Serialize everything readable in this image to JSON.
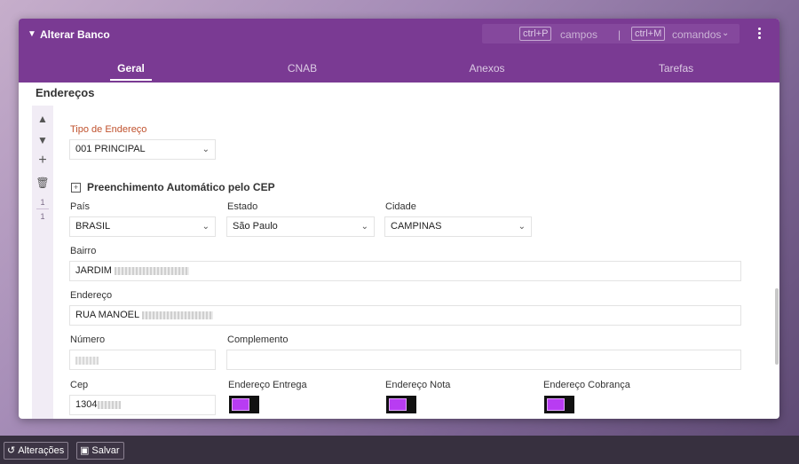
{
  "dialog": {
    "title": "Alterar Banco",
    "shortcuts": {
      "fields_key": "ctrl+P",
      "fields_label": "campos",
      "separator": "|",
      "commands_key": "ctrl+M",
      "commands_label": "comandos"
    },
    "tabs": [
      "Geral",
      "CNAB",
      "Anexos",
      "Tarefas"
    ],
    "active_tab": "Geral"
  },
  "section": {
    "title": "Endereços",
    "rail": {
      "counter_current": "1",
      "counter_total": "1"
    }
  },
  "form": {
    "address_type": {
      "label": "Tipo de Endereço",
      "value": "001 PRINCIPAL"
    },
    "auto_fill_title": "Preenchimento Automático pelo CEP",
    "country": {
      "label": "País",
      "value": "BRASIL"
    },
    "state": {
      "label": "Estado",
      "value": "São Paulo"
    },
    "city": {
      "label": "Cidade",
      "value": "CAMPINAS"
    },
    "neighborhood": {
      "label": "Bairro",
      "value": "JARDIM"
    },
    "street": {
      "label": "Endereço",
      "value": "RUA MANOEL"
    },
    "number": {
      "label": "Número",
      "value": ""
    },
    "complement": {
      "label": "Complemento",
      "value": ""
    },
    "cep": {
      "label": "Cep",
      "value": "1304"
    },
    "toggles": [
      {
        "label": "Endereço Entrega",
        "on": true
      },
      {
        "label": "Endereço Nota",
        "on": true
      },
      {
        "label": "Endereço Cobrança",
        "on": true
      }
    ]
  },
  "footer": {
    "changes_label": "Alterações",
    "save_label": "Salvar"
  },
  "colors": {
    "header": "#7a3a93",
    "toggle_on": "#b83cf2",
    "required_label": "#c0522e",
    "footer": "#37303f"
  }
}
